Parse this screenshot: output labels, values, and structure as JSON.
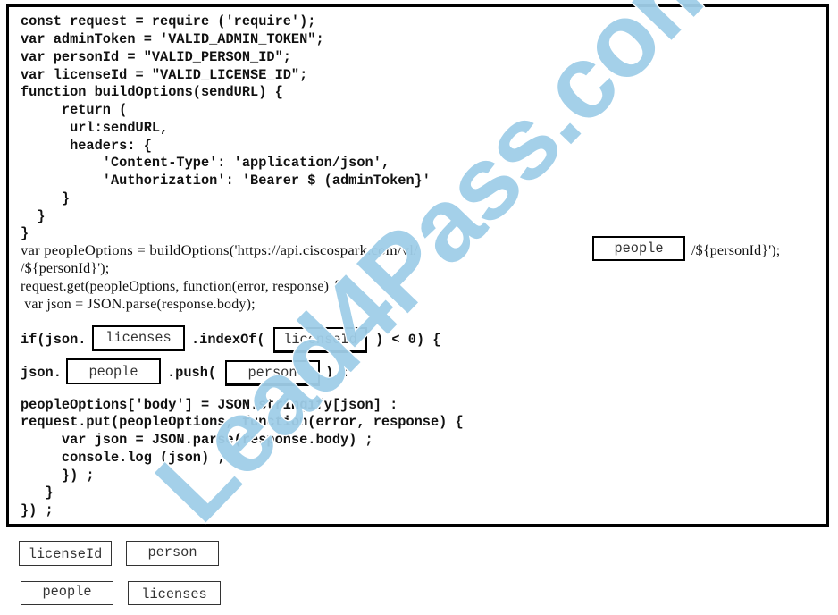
{
  "question": {
    "code_lines": [
      "const request = require ('require');",
      "var adminToken = 'VALID_ADMIN_TOKEN\";",
      "var personId = \"VALID_PERSON_ID\";",
      "var licenseId = \"VALID_LICENSE_ID\";",
      "function buildOptions(sendURL) {",
      "     return (",
      "      url:sendURL,",
      "      headers: {",
      "          'Content-Type': 'application/json',",
      "          'Authorization': 'Bearer $ (adminToken}'",
      "     }",
      "  }",
      "}",
      "var peopleOptions = buildOptions('https://api.ciscospark.com/vl/",
      "/${personId}');",
      "/${personId}');",
      "request.get(peopleOptions, function(error, response) {",
      " var json = JSON.parse(response.body);",
      "if(json.",
      ".indexOf(",
      ") < 0) {",
      "json.",
      ".push(",
      ") :",
      "peopleOptions['body'] = JSON.stringify[json] :",
      "request.put(peopleOptions, function(error, response) {",
      "     var json = JSON.parse(response.body) ;",
      "     console.log (json) ;",
      "     }) ;",
      "   }",
      "}) ;"
    ],
    "drop_targets": {
      "url_segment": "people",
      "json_property_check": "licenses",
      "index_of_arg": "licenseId",
      "json_property_push": "people",
      "push_arg": "person"
    }
  },
  "answer_options": [
    "licenseId",
    "person",
    "people",
    "licenses"
  ],
  "watermark": {
    "text": "Lead4Pass.com",
    "color": "#9fcde8"
  }
}
